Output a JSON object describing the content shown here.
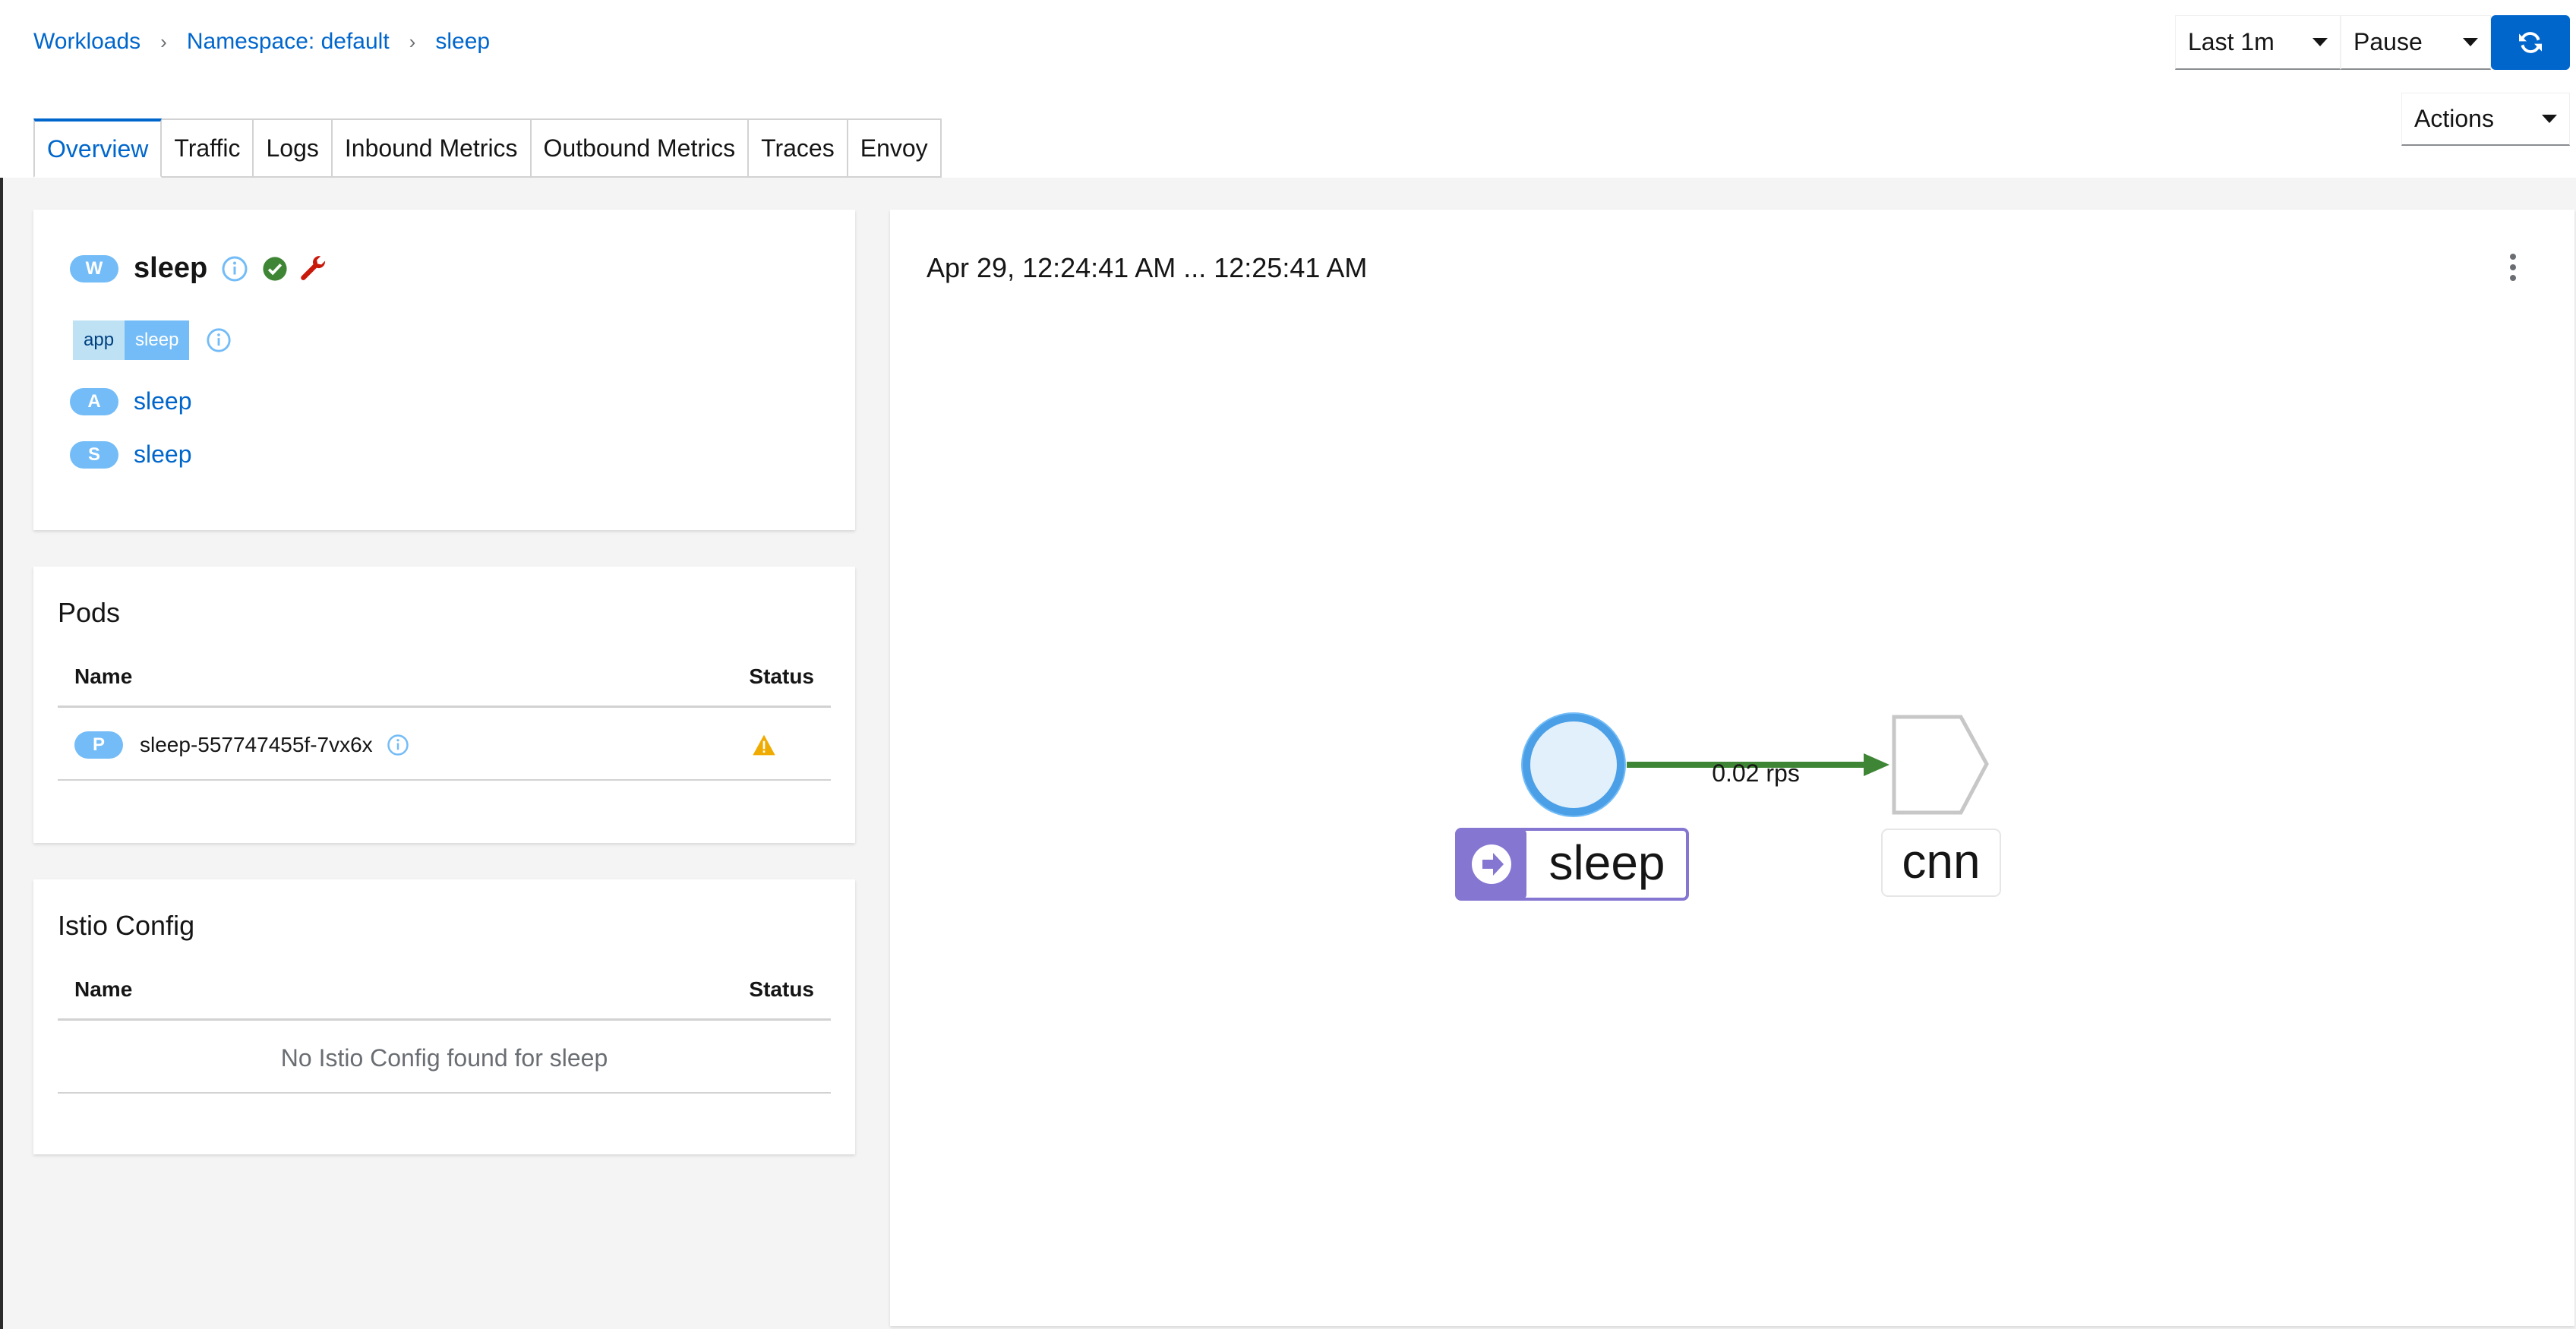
{
  "breadcrumb": {
    "workloads": "Workloads",
    "namespace": "Namespace: default",
    "current": "sleep"
  },
  "controls": {
    "range": "Last 1m",
    "pause": "Pause",
    "actions": "Actions"
  },
  "tabs": [
    "Overview",
    "Traffic",
    "Logs",
    "Inbound Metrics",
    "Outbound Metrics",
    "Traces",
    "Envoy"
  ],
  "workload": {
    "badge": "W",
    "name": "sleep",
    "label_key": "app",
    "label_value": "sleep",
    "app_badge": "A",
    "app_link": "sleep",
    "service_badge": "S",
    "service_link": "sleep"
  },
  "pods": {
    "title": "Pods",
    "col_name": "Name",
    "col_status": "Status",
    "rows": [
      {
        "badge": "P",
        "name": "sleep-557747455f-7vx6x"
      }
    ]
  },
  "istio": {
    "title": "Istio Config",
    "col_name": "Name",
    "col_status": "Status",
    "empty": "No Istio Config found for sleep"
  },
  "graph": {
    "time_range": "Apr 29, 12:24:41 AM ... 12:25:41 AM",
    "edge_label": "0.02 rps",
    "source_node": "sleep",
    "target_node": "cnn"
  },
  "colors": {
    "accent": "#0066cc",
    "ok": "#3e8635",
    "danger": "#c9190b",
    "warning": "#f0ab00",
    "node": "#8476d1"
  }
}
